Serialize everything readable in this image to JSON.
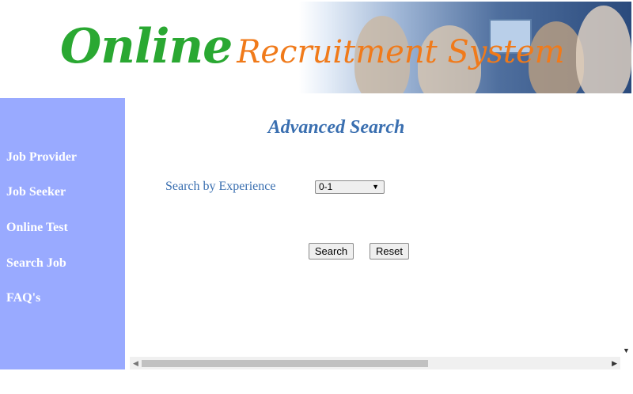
{
  "banner": {
    "logo_word1": "Online",
    "logo_word2": "Recruitment System"
  },
  "sidebar": {
    "items": [
      {
        "label": "Job Provider"
      },
      {
        "label": "Job Seeker"
      },
      {
        "label": "Online Test"
      },
      {
        "label": "Search Job"
      },
      {
        "label": "FAQ's"
      }
    ]
  },
  "main": {
    "title": "Advanced Search",
    "experience_label": "Search by Experience",
    "experience_select_value": "0-1",
    "search_button": "Search",
    "reset_button": "Reset"
  },
  "colors": {
    "sidebar_bg": "#99aaff",
    "title_blue": "#3a6fb0",
    "logo_green": "#2aa832",
    "logo_orange": "#f07a1a"
  }
}
